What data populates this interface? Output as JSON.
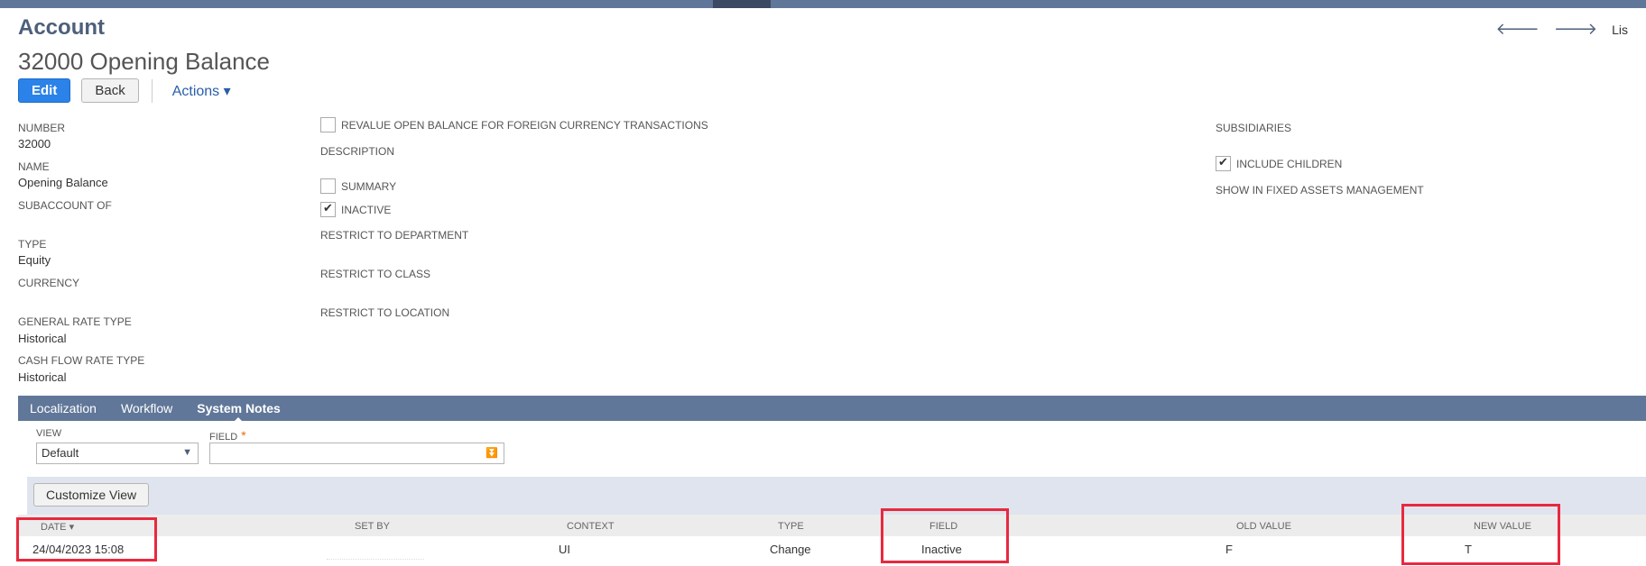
{
  "header": {
    "record_type": "Account",
    "title": "32000 Opening Balance",
    "list_link": "Lis"
  },
  "buttons": {
    "edit": "Edit",
    "back": "Back",
    "actions": "Actions ▾"
  },
  "fields": {
    "number_label": "NUMBER",
    "number_value": "32000",
    "name_label": "NAME",
    "name_value": "Opening Balance",
    "subaccount_label": "SUBACCOUNT OF",
    "type_label": "TYPE",
    "type_value": "Equity",
    "currency_label": "CURRENCY",
    "general_rate_label": "GENERAL RATE TYPE",
    "general_rate_value": "Historical",
    "cash_flow_label": "CASH FLOW RATE TYPE",
    "cash_flow_value": "Historical",
    "revalue_label": "REVALUE OPEN BALANCE FOR FOREIGN CURRENCY TRANSACTIONS",
    "description_label": "DESCRIPTION",
    "summary_label": "SUMMARY",
    "inactive_label": "INACTIVE",
    "restrict_dept_label": "RESTRICT TO DEPARTMENT",
    "restrict_class_label": "RESTRICT TO CLASS",
    "restrict_location_label": "RESTRICT TO LOCATION",
    "subsidiaries_label": "SUBSIDIARIES",
    "include_children_label": "INCLUDE CHILDREN",
    "fixed_assets_label": "SHOW IN FIXED ASSETS MANAGEMENT"
  },
  "checkboxes": {
    "revalue": false,
    "summary": false,
    "inactive": true,
    "include_children": true
  },
  "subtabs": [
    "Localization",
    "Workflow",
    "System Notes"
  ],
  "filters": {
    "view_label": "VIEW",
    "view_value": "Default",
    "field_label": "FIELD",
    "required_mark": "*",
    "field_value": ""
  },
  "list": {
    "customize_button": "Customize View",
    "columns": [
      "DATE ▾",
      "SET BY",
      "CONTEXT",
      "TYPE",
      "FIELD",
      "OLD VALUE",
      "NEW VALUE"
    ],
    "rows": [
      {
        "date": "24/04/2023 15:08",
        "set_by": "",
        "context": "UI",
        "type": "Change",
        "field": "Inactive",
        "old_value": "F",
        "new_value": "T"
      }
    ]
  },
  "colors": {
    "nav_bar": "#607799",
    "primary_button": "#2b82e8",
    "highlight": "#e8293f"
  }
}
